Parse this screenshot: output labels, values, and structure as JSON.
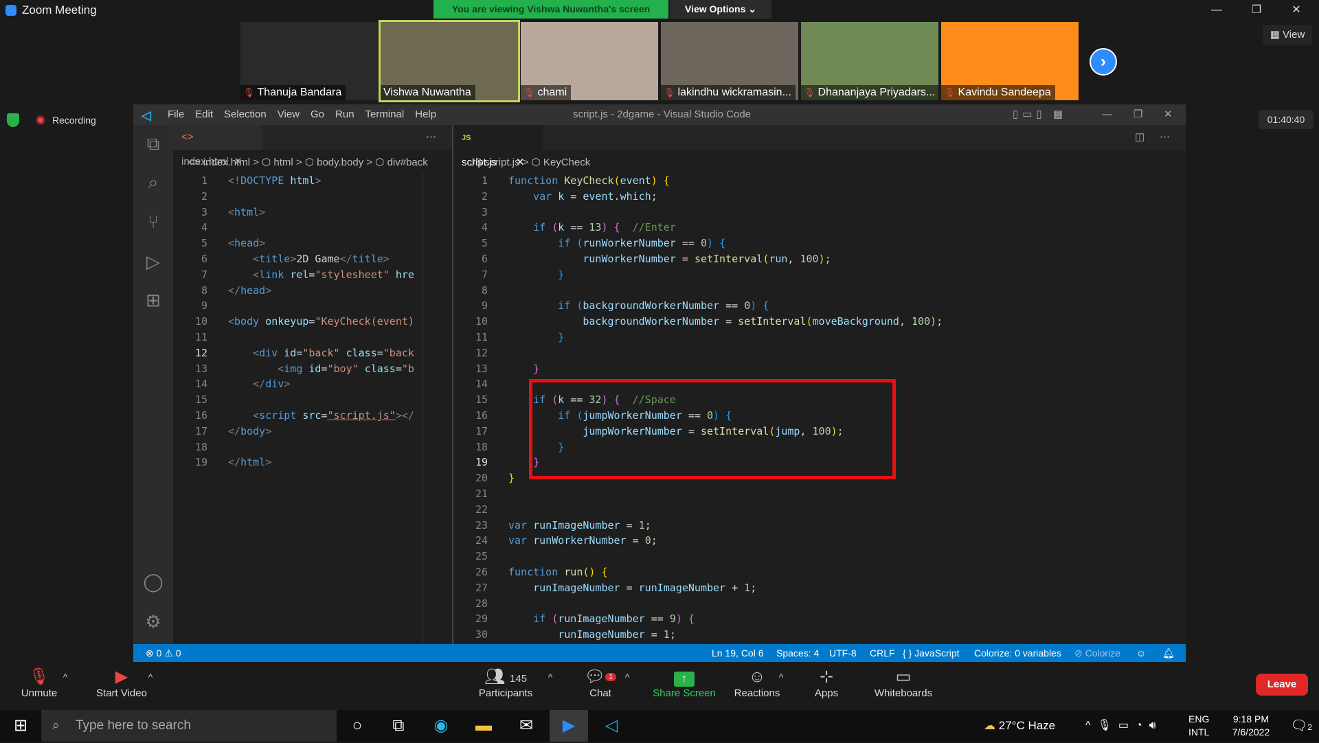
{
  "window": {
    "title": "Zoom Meeting",
    "banner": "You are viewing Vishwa Nuwantha's screen",
    "view_options": "View Options ⌄",
    "view": "View",
    "recording": "Recording",
    "timer": "01:40:40"
  },
  "participants": [
    {
      "name": "Thanuja Bandara",
      "muted": true,
      "color": "#2a2a2a"
    },
    {
      "name": "Vishwa Nuwantha",
      "muted": false,
      "color": "#6e6a52"
    },
    {
      "name": "chami",
      "muted": true,
      "color": "#b8a79a"
    },
    {
      "name": "lakindhu wickramasin...",
      "muted": true,
      "color": "#6c665c"
    },
    {
      "name": "Dhananjaya Priyadars...",
      "muted": true,
      "color": "#6f8a55"
    },
    {
      "name": "Kavindu Sandeepa",
      "muted": true,
      "color": "#ff8c1a"
    }
  ],
  "vscode": {
    "menu": [
      "File",
      "Edit",
      "Selection",
      "View",
      "Go",
      "Run",
      "Terminal",
      "Help"
    ],
    "window_title": "script.js - 2dgame - Visual Studio Code",
    "left_tab": "index.html",
    "right_tab": "script.js",
    "left_breadcrumb": "<> index.html > ⬡ html > ⬡ body.body > ⬡ div#back",
    "right_breadcrumb": "JS script.js > ⬡ KeyCheck",
    "left_lines": 19,
    "right_lines": 30,
    "status": {
      "errors": "⊗ 0 ⚠ 0",
      "position": "Ln 19, Col 6",
      "spaces": "Spaces: 4",
      "encoding": "UTF-8",
      "eol": "CRLF",
      "language": "{ } JavaScript",
      "colorize_vars": "Colorize: 0 variables",
      "colorize": "⊘ Colorize"
    }
  },
  "zoom_bar": {
    "unmute": "Unmute",
    "start_video": "Start Video",
    "participants": "Participants",
    "participants_count": "145",
    "chat": "Chat",
    "chat_badge": "1",
    "share": "Share Screen",
    "reactions": "Reactions",
    "apps": "Apps",
    "whiteboards": "Whiteboards",
    "leave": "Leave"
  },
  "taskbar": {
    "search": "Type here to search",
    "weather": "27°C  Haze",
    "lang1": "ENG",
    "lang2": "INTL",
    "time": "9:18 PM",
    "date": "7/6/2022",
    "notif": "2"
  }
}
